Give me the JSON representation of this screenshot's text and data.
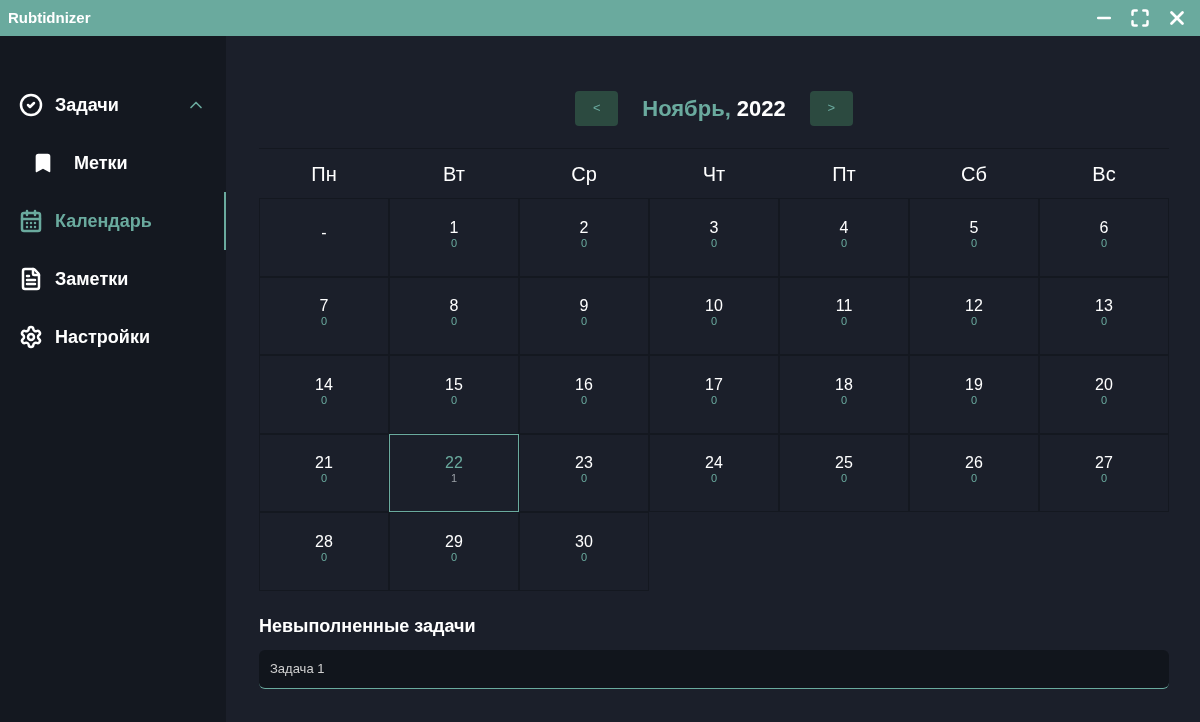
{
  "window": {
    "title": "Rubtidnizer"
  },
  "sidebar": {
    "items": [
      {
        "label": "Задачи",
        "selected": false,
        "expanded": true,
        "children": [
          {
            "label": "Метки",
            "selected": false
          }
        ]
      },
      {
        "label": "Календарь",
        "selected": true
      },
      {
        "label": "Заметки",
        "selected": false
      },
      {
        "label": "Настройки",
        "selected": false
      }
    ]
  },
  "calendar": {
    "prev": "<",
    "next": ">",
    "month": "Ноябрь,",
    "year": "2022",
    "weekdays": [
      "Пн",
      "Вт",
      "Ср",
      "Чт",
      "Пт",
      "Сб",
      "Вс"
    ],
    "days": [
      {
        "day": "-",
        "selected": false
      },
      {
        "day": "1",
        "count": "0",
        "selected": false
      },
      {
        "day": "2",
        "count": "0",
        "selected": false
      },
      {
        "day": "3",
        "count": "0",
        "selected": false
      },
      {
        "day": "4",
        "count": "0",
        "selected": false
      },
      {
        "day": "5",
        "count": "0",
        "selected": false
      },
      {
        "day": "6",
        "count": "0",
        "selected": false
      },
      {
        "day": "7",
        "count": "0",
        "selected": false
      },
      {
        "day": "8",
        "count": "0",
        "selected": false
      },
      {
        "day": "9",
        "count": "0",
        "selected": false
      },
      {
        "day": "10",
        "count": "0",
        "selected": false
      },
      {
        "day": "11",
        "count": "0",
        "selected": false
      },
      {
        "day": "12",
        "count": "0",
        "selected": false
      },
      {
        "day": "13",
        "count": "0",
        "selected": false
      },
      {
        "day": "14",
        "count": "0",
        "selected": false
      },
      {
        "day": "15",
        "count": "0",
        "selected": false
      },
      {
        "day": "16",
        "count": "0",
        "selected": false
      },
      {
        "day": "17",
        "count": "0",
        "selected": false
      },
      {
        "day": "18",
        "count": "0",
        "selected": false
      },
      {
        "day": "19",
        "count": "0",
        "selected": false
      },
      {
        "day": "20",
        "count": "0",
        "selected": false
      },
      {
        "day": "21",
        "count": "0",
        "selected": false
      },
      {
        "day": "22",
        "count": "1",
        "selected": true
      },
      {
        "day": "23",
        "count": "0",
        "selected": false
      },
      {
        "day": "24",
        "count": "0",
        "selected": false
      },
      {
        "day": "25",
        "count": "0",
        "selected": false
      },
      {
        "day": "26",
        "count": "0",
        "selected": false
      },
      {
        "day": "27",
        "count": "0",
        "selected": false
      },
      {
        "day": "28",
        "count": "0",
        "selected": false
      },
      {
        "day": "29",
        "count": "0",
        "selected": false
      },
      {
        "day": "30",
        "count": "0",
        "selected": false
      }
    ]
  },
  "pending": {
    "title": "Невыполненные задачи",
    "tasks": [
      "Задача 1"
    ]
  }
}
